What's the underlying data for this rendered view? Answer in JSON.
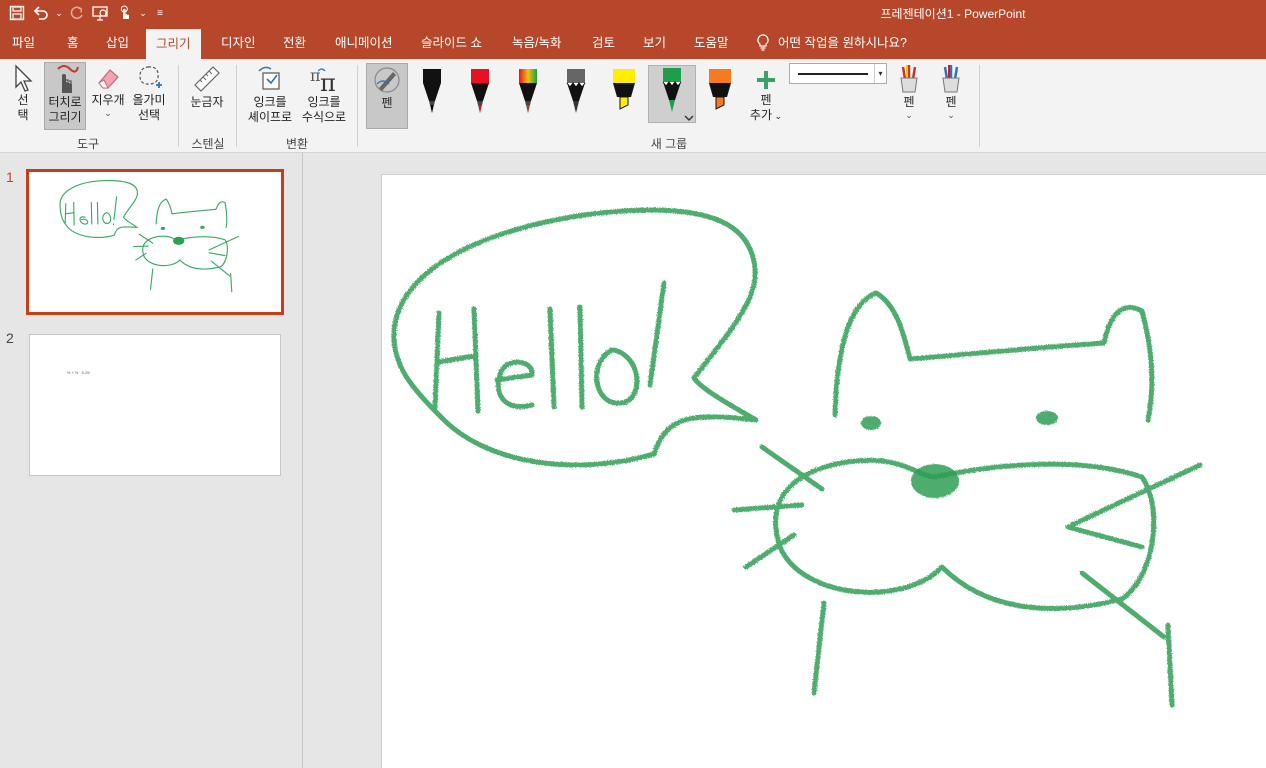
{
  "window": {
    "doc_name": "프레젠테이션1",
    "separator": " - ",
    "app_name": "PowerPoint"
  },
  "qat": {
    "save_icon": "save-icon",
    "undo_icon": "undo-icon",
    "redo_icon": "redo-icon",
    "slideshow_icon": "slideshow-icon",
    "touch_icon": "touch-mode-icon",
    "customize_icon": "customize-qat-icon"
  },
  "tabs": [
    {
      "label": "파일"
    },
    {
      "label": "홈"
    },
    {
      "label": "삽입"
    },
    {
      "label": "그리기"
    },
    {
      "label": "디자인"
    },
    {
      "label": "전환"
    },
    {
      "label": "애니메이션"
    },
    {
      "label": "슬라이드 쇼"
    },
    {
      "label": "녹음/녹화"
    },
    {
      "label": "검토"
    },
    {
      "label": "보기"
    },
    {
      "label": "도움말"
    }
  ],
  "active_tab": "그리기",
  "tell_me": "어떤 작업을 원하시나요?",
  "ribbon": {
    "tools": {
      "group_label": "도구",
      "select_line1": "선",
      "select_line2": "택",
      "touch_line1": "터치로",
      "touch_line2": "그리기",
      "eraser": "지우개",
      "lasso_line1": "올가미",
      "lasso_line2": "선택"
    },
    "stencils": {
      "group_label": "스텐실",
      "ruler": "눈금자"
    },
    "convert": {
      "group_label": "변환",
      "ink_shape_line1": "잉크를",
      "ink_shape_line2": "셰이프로",
      "ink_math_line1": "잉크를",
      "ink_math_line2": "수식으로"
    },
    "pens": {
      "group_label": "새 그룹",
      "pen_label": "펜",
      "add_pen_line1": "펜",
      "add_pen_line2": "추가",
      "pen_colors": [
        "#000000",
        "#e81123",
        "galaxy",
        "#666666",
        "#ffee00",
        "#1e9e4a",
        "#f47b20"
      ],
      "pencil_label_1": "펜",
      "pencil_label_2": "펜"
    }
  },
  "slides": [
    {
      "number": "1"
    },
    {
      "number": "2",
      "formula": "½ + ½ · 0.25"
    }
  ],
  "slide_content": {
    "ink_color": "#2e9e55",
    "handwriting": "Hello!"
  },
  "colors": {
    "accent": "#b7472a",
    "selection": "#c43e1c"
  }
}
